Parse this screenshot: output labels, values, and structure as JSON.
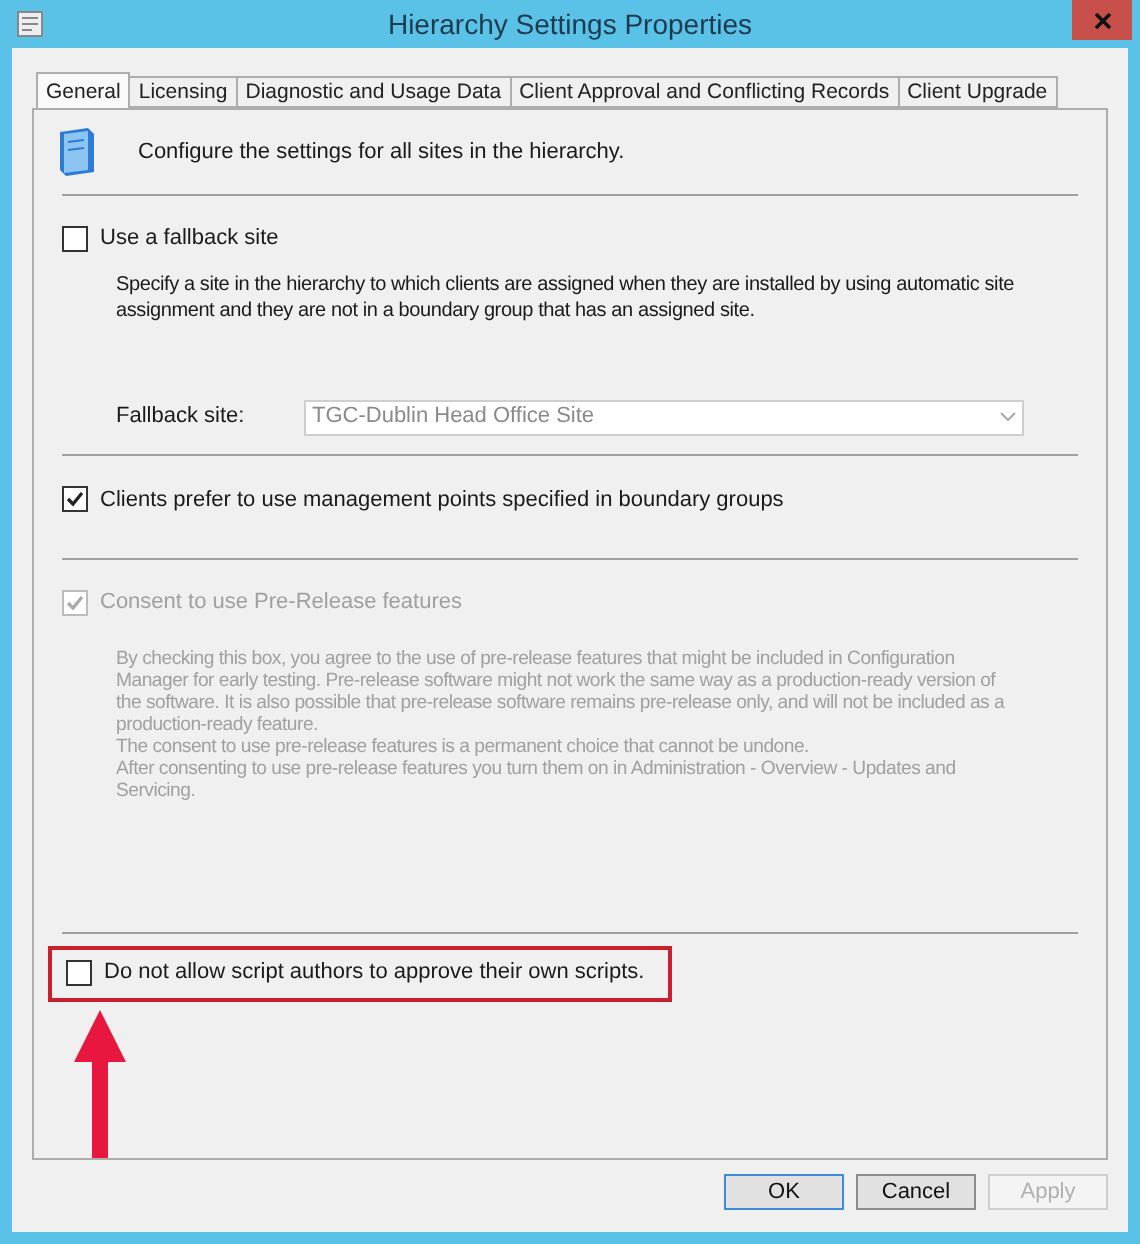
{
  "window": {
    "title": "Hierarchy Settings Properties"
  },
  "tabs": [
    {
      "label": "General",
      "selected": true
    },
    {
      "label": "Licensing",
      "selected": false
    },
    {
      "label": "Diagnostic and Usage Data",
      "selected": false
    },
    {
      "label": "Client Approval and Conflicting Records",
      "selected": false
    },
    {
      "label": "Client Upgrade",
      "selected": false
    }
  ],
  "header": {
    "text": "Configure the settings for all sites in the hierarchy."
  },
  "fallback": {
    "checkbox": {
      "label": "Use a fallback site",
      "checked": false,
      "disabled": false
    },
    "description": "Specify a site in the hierarchy to which clients are assigned when they are installed by using automatic site assignment and they are not in a boundary group that has an assigned site.",
    "field_label": "Fallback site:",
    "value": "TGC-Dublin Head Office Site",
    "disabled": true
  },
  "management_points": {
    "label": "Clients prefer to use management points specified in boundary groups",
    "checked": true,
    "disabled": false
  },
  "prerelease": {
    "checkbox": {
      "label": "Consent to use Pre-Release features",
      "checked": true,
      "disabled": true
    },
    "description": [
      "By checking this box, you agree to the use of pre-release features that might be included in Configuration Manager for early testing. Pre-release software might not work the same way as a production-ready version of the software. It is also possible that pre-release software remains pre-release only, and will not be included as a production-ready feature.",
      "The consent to use pre-release features is a permanent choice that cannot be undone.",
      "After consenting to use pre-release features you turn them on in Administration - Overview - Updates and Servicing."
    ]
  },
  "scripts": {
    "label": "Do not allow script authors to approve their own scripts.",
    "checked": false,
    "disabled": false,
    "highlighted": true
  },
  "buttons": [
    {
      "label": "OK",
      "disabled": false,
      "default": true
    },
    {
      "label": "Cancel",
      "disabled": false,
      "default": false
    },
    {
      "label": "Apply",
      "disabled": true,
      "default": false
    }
  ]
}
